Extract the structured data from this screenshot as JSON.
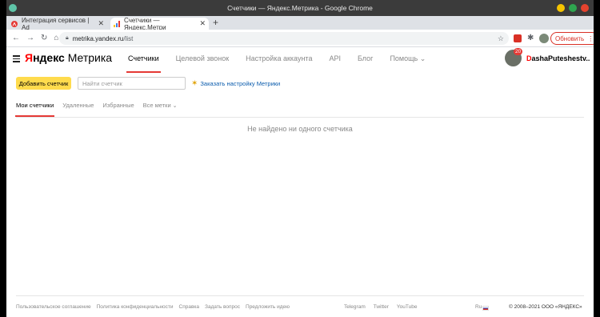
{
  "window": {
    "title": "Счетчики — Яндекс.Метрика - Google Chrome"
  },
  "tabs": [
    {
      "label": "Интеграция сервисов | Ad"
    },
    {
      "label": "Счетчики — Яндекс.Метри"
    }
  ],
  "tab_new": "+",
  "address": {
    "host": "metrika.yandex.ru",
    "path": "/list"
  },
  "ext": {
    "badge": ""
  },
  "update_button": {
    "label": "Обновить",
    "dots": "⋮"
  },
  "logo": {
    "y": "Я",
    "rest": "ндекс",
    "product": "Метрика"
  },
  "nav": [
    {
      "label": "Счетчики"
    },
    {
      "label": "Целевой звонок"
    },
    {
      "label": "Настройка аккаунта"
    },
    {
      "label": "API"
    },
    {
      "label": "Блог"
    },
    {
      "label": "Помощь"
    }
  ],
  "user": {
    "badge": "20",
    "name_first": "D",
    "name_rest": "ashaPuteshestv..."
  },
  "toolbar": {
    "add_button": "Добавить счетчик",
    "search_placeholder": "Найти счетчик",
    "order_link": "Заказать настройку Метрики"
  },
  "subtabs": [
    {
      "label": "Мои счетчики"
    },
    {
      "label": "Удаленные"
    },
    {
      "label": "Избранные"
    },
    {
      "label": "Все метки"
    }
  ],
  "empty_message": "Не найдено ни одного счетчика",
  "footer": {
    "links": [
      "Пользовательское соглашение",
      "Политика конфиденциальности",
      "Справка",
      "Задать вопрос",
      "Предложить идею"
    ],
    "social": [
      "Telegram",
      "Twitter",
      "YouTube"
    ],
    "lang": "Ru",
    "copyright": "© 2008–2021  ООО «ЯНДЕКС»"
  },
  "colors": {
    "accent_red": "#e53935",
    "button_yellow": "#ffdb4d",
    "link_blue": "#0b5cad"
  }
}
